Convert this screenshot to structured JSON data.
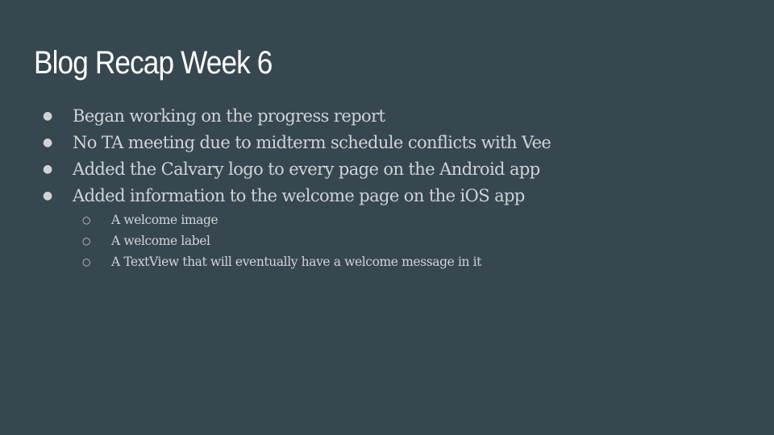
{
  "slide": {
    "title": "Blog Recap Week 6",
    "bullets": [
      "Began working on the progress report",
      "No TA meeting due to midterm schedule conflicts with Vee",
      "Added the Calvary logo to every page on the Android app",
      "Added information to the welcome page on the iOS app"
    ],
    "subbullets": [
      "A welcome image",
      "A welcome label",
      "A TextView that will eventually have a welcome message in it"
    ],
    "bullet_glyph": "●",
    "subbullet_glyph": "○"
  },
  "colors": {
    "background": "#37474f",
    "title": "#ffffff",
    "body_text": "#cfd3d6"
  }
}
